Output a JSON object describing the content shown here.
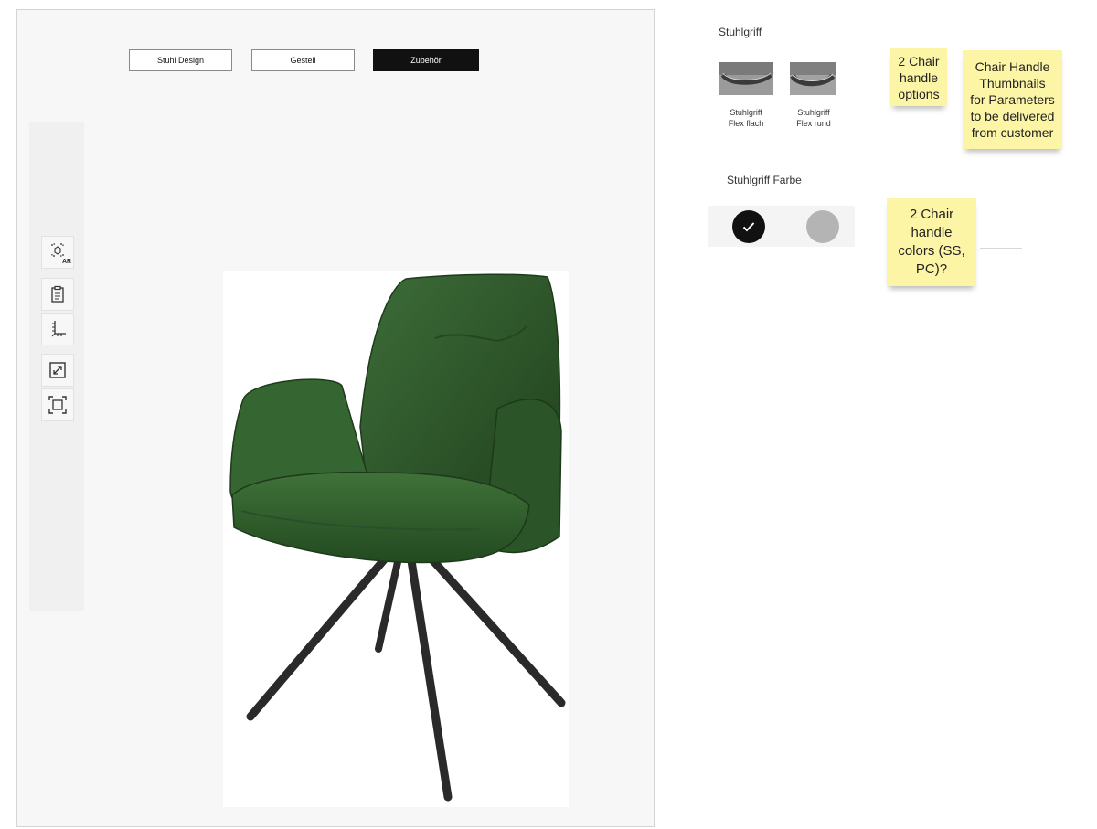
{
  "tabs": [
    {
      "label": "Stuhl Design",
      "active": false
    },
    {
      "label": "Gestell",
      "active": false
    },
    {
      "label": "Zubehör",
      "active": true
    }
  ],
  "toolbar": {
    "ar_label": "AR",
    "tools": [
      "ar-view-icon",
      "clipboard-icon",
      "measure-icon",
      "expand-icon",
      "fit-frame-icon"
    ]
  },
  "product": {
    "image": "green-velvet-armchair",
    "colors": {
      "fabric": "#2f5a2c",
      "fabric_shadow": "#1f3f1d",
      "legs": "#2a2a2a"
    }
  },
  "handle_section": {
    "title": "Stuhlgriff",
    "options": [
      {
        "label": "Stuhlgriff\nFlex flach"
      },
      {
        "label": "Stuhlgriff\nFlex rund"
      }
    ]
  },
  "color_section": {
    "title": "Stuhlgriff Farbe",
    "swatches": [
      {
        "color": "#111111",
        "selected": true
      },
      {
        "color": "#b4b4b4",
        "selected": false
      }
    ]
  },
  "notes": [
    {
      "text": "2 Chair\nhandle\noptions"
    },
    {
      "text": "Chair Handle\nThumbnails\nfor Parameters\nto be delivered\nfrom customer"
    },
    {
      "text": "2 Chair\nhandle\ncolors (SS,\nPC)?"
    }
  ],
  "accent_colors": {
    "sticky": "#fdf5a6",
    "active_tab": "#111111"
  }
}
